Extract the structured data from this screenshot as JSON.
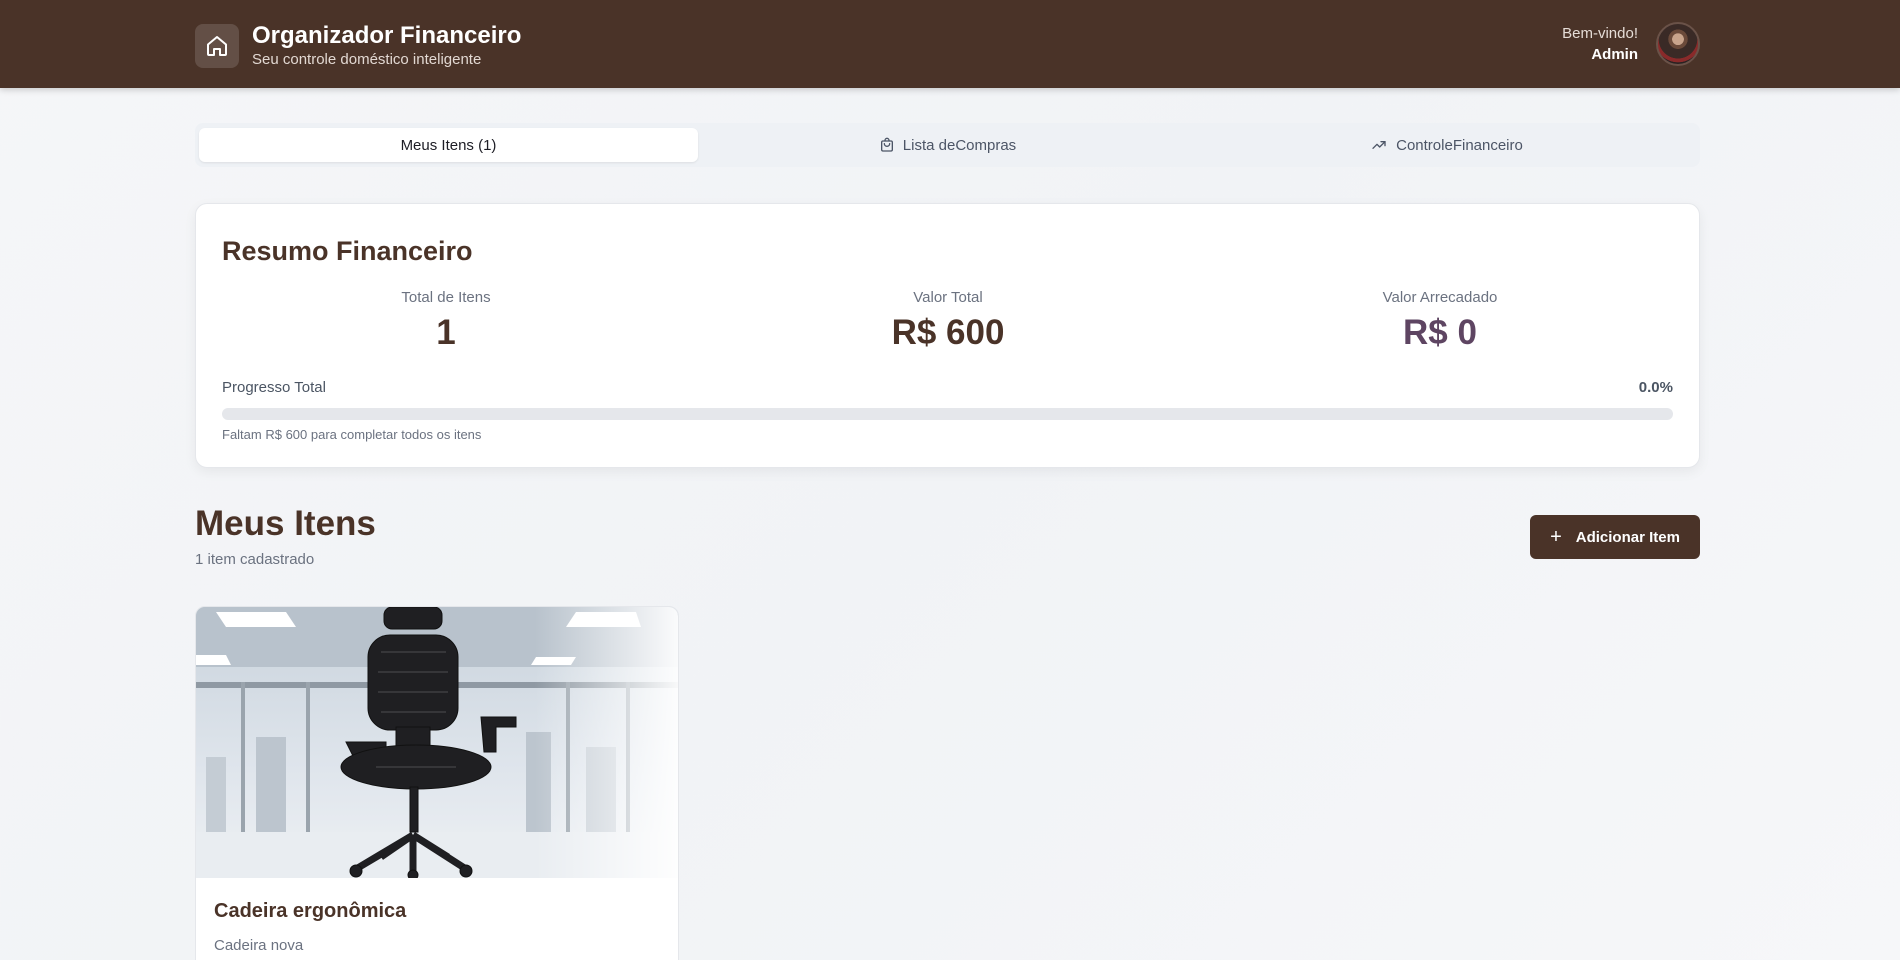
{
  "header": {
    "title": "Organizador Financeiro",
    "subtitle": "Seu controle doméstico inteligente",
    "greeting": "Bem-vindo!",
    "username": "Admin",
    "brand_icon": "home-icon"
  },
  "tabs": [
    {
      "label": "Meus Itens (1)",
      "icon": "",
      "active": true
    },
    {
      "label": "Lista deCompras",
      "icon": "shopping-bag-icon",
      "active": false
    },
    {
      "label": "ControleFinanceiro",
      "icon": "trending-up-icon",
      "active": false
    }
  ],
  "summary": {
    "title": "Resumo Financeiro",
    "stats": [
      {
        "label": "Total de Itens",
        "value": "1",
        "color": "#4a3328"
      },
      {
        "label": "Valor Total",
        "value": "R$ 600",
        "color": "#4a3328"
      },
      {
        "label": "Valor Arrecadado",
        "value": "R$ 0",
        "color": "#5e4562"
      }
    ],
    "progress_label": "Progresso Total",
    "progress_percent_text": "0.0%",
    "progress_fraction": 0.0,
    "progress_note": "Faltam R$ 600 para completar todos os itens"
  },
  "section": {
    "title": "Meus Itens",
    "subtitle": "1 item cadastrado",
    "add_button_label": "Adicionar Item"
  },
  "items": [
    {
      "name": "Cadeira ergonômica",
      "description": "Cadeira nova"
    }
  ],
  "colors": {
    "brand": "#4a3328",
    "accent_purple": "#5e4562"
  }
}
